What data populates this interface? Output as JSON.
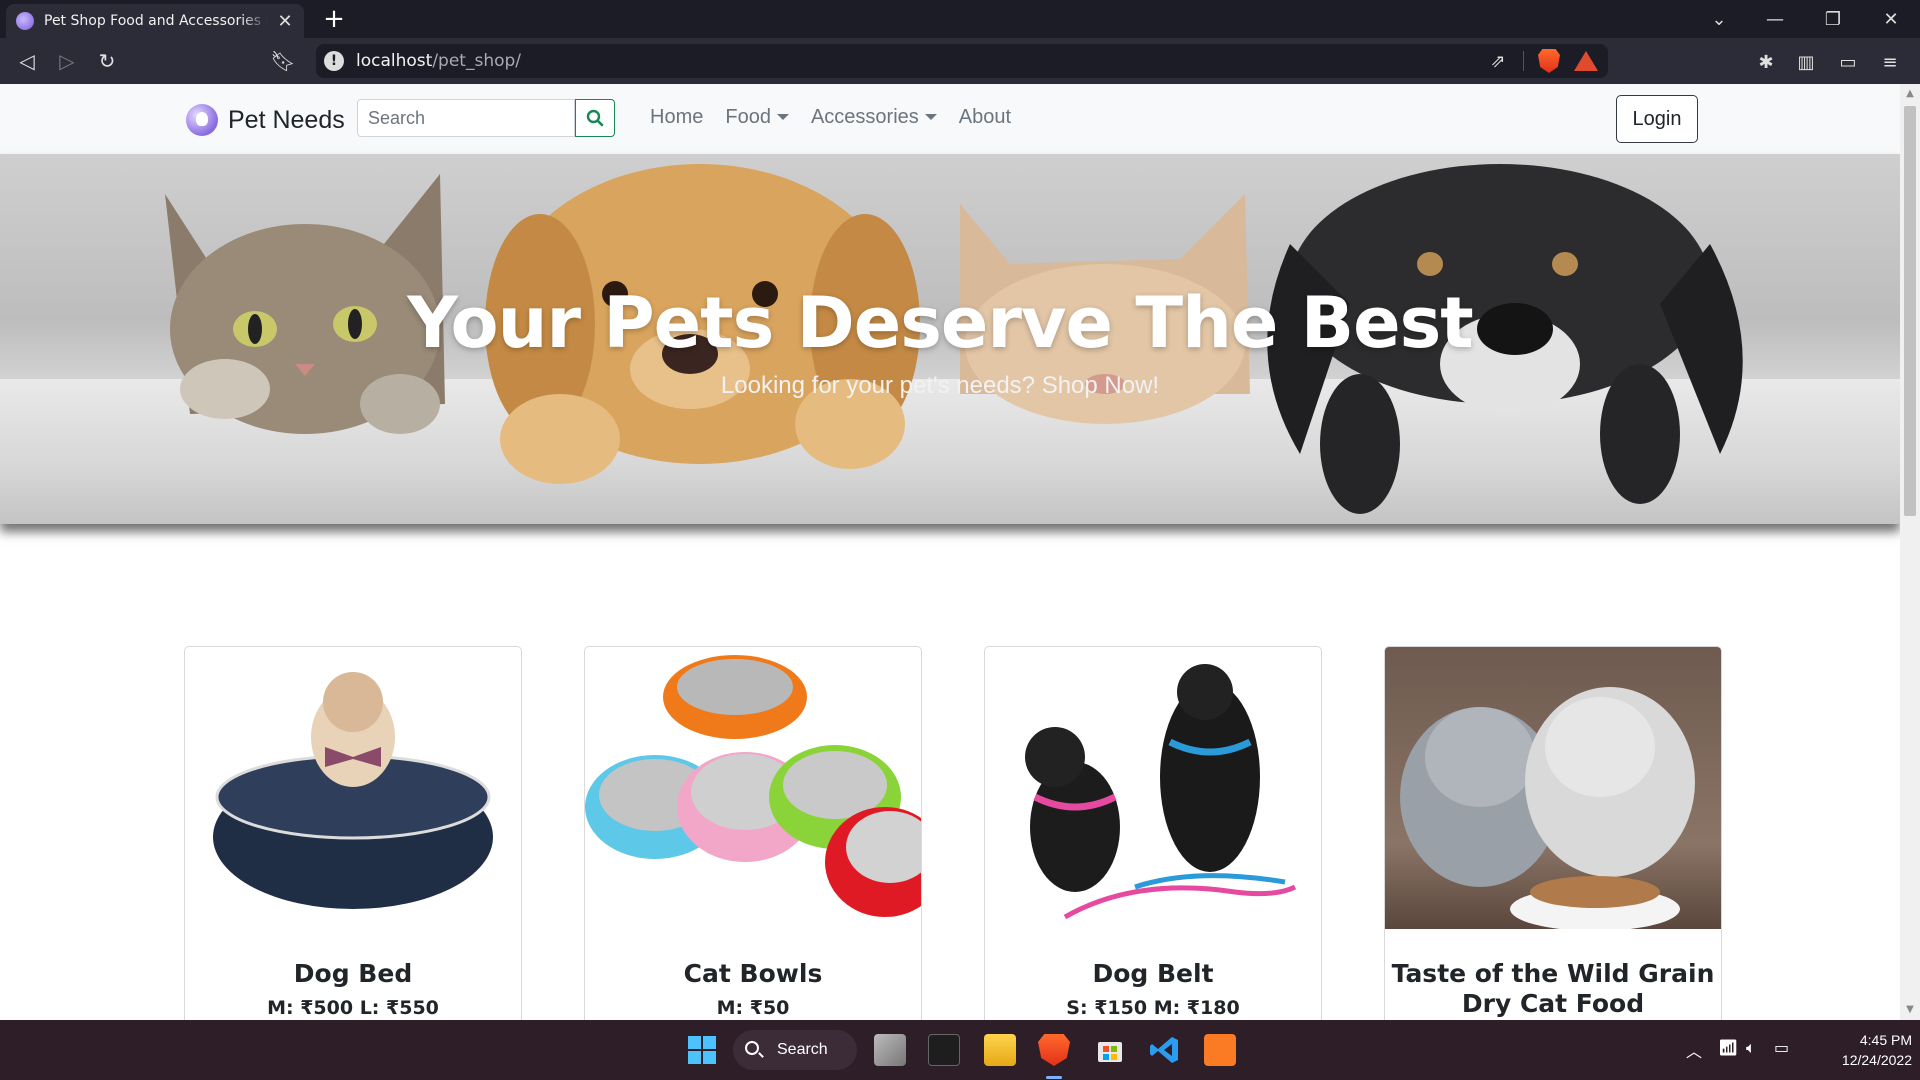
{
  "browser": {
    "tab_title": "Pet Shop Food and Accessories Shop",
    "url_host": "localhost",
    "url_path": "/pet_shop/"
  },
  "navbar": {
    "brand": "Pet Needs",
    "search_placeholder": "Search",
    "links": [
      "Home",
      "Food",
      "Accessories",
      "About"
    ],
    "login_label": "Login"
  },
  "hero": {
    "title": "Your Pets Deserve The Best",
    "subtitle": "Looking for your pet's needs? Shop Now!"
  },
  "products": [
    {
      "name": "Dog Bed",
      "price": "M: ₹500 L: ₹550"
    },
    {
      "name": "Cat Bowls",
      "price": "M: ₹50"
    },
    {
      "name": "Dog Belt",
      "price": "S: ₹150 M: ₹180"
    },
    {
      "name": "Taste of the Wild Grain Dry Cat Food",
      "price": ""
    }
  ],
  "taskbar": {
    "search_label": "Search",
    "time": "4:45 PM",
    "date": "12/24/2022"
  }
}
